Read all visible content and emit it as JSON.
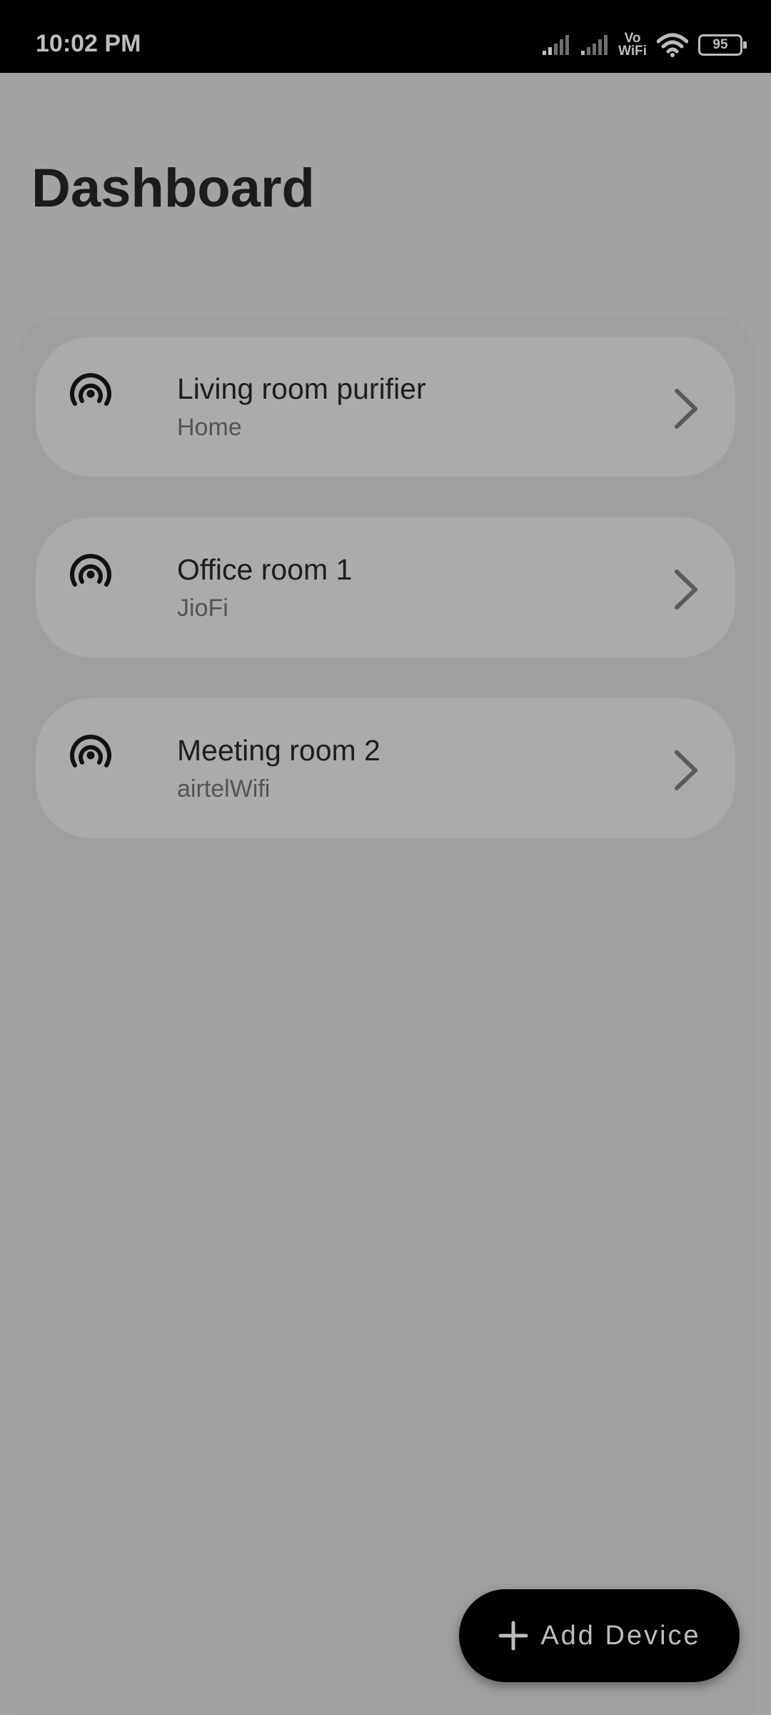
{
  "status_bar": {
    "time": "10:02 PM",
    "vowifi_top": "Vo",
    "vowifi_bottom": "WiFi",
    "battery": "95"
  },
  "page": {
    "title": "Dashboard"
  },
  "devices": [
    {
      "name": "Living room purifier",
      "network": "Home"
    },
    {
      "name": "Office room 1",
      "network": "JioFi"
    },
    {
      "name": "Meeting room 2",
      "network": "airtelWifi"
    }
  ],
  "fab": {
    "label": "Add Device"
  },
  "colors": {
    "background": "#a3a3a3",
    "card": "#ababab",
    "status_bar": "#000000",
    "fab": "#000000"
  },
  "icons": {
    "device": "sensors-icon",
    "chevron": "chevron-right-icon",
    "fab": "add-icon"
  }
}
